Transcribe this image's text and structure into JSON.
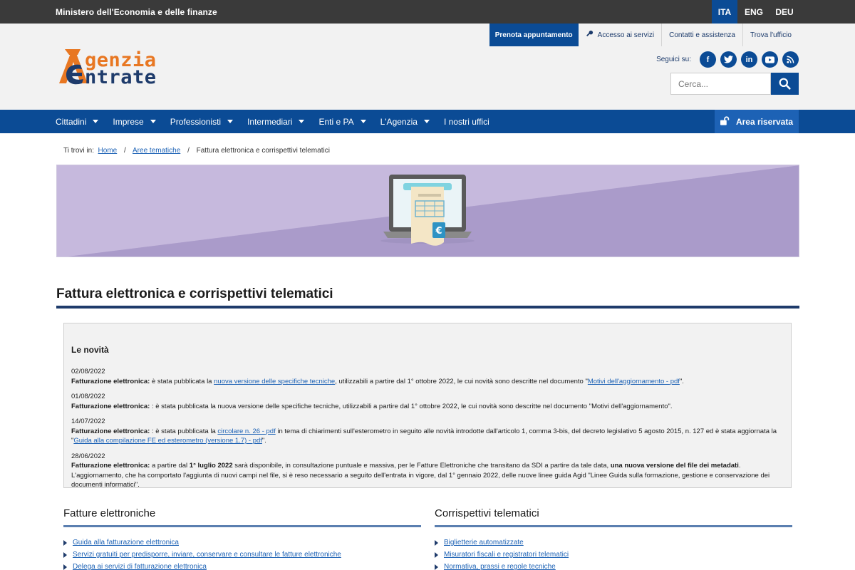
{
  "topbar": {
    "ministry": "Ministero dell'Economia e delle finanze",
    "languages": [
      {
        "label": "ITA",
        "active": true
      },
      {
        "label": "ENG",
        "active": false
      },
      {
        "label": "DEU",
        "active": false
      }
    ]
  },
  "logo": {
    "line1": "genzia",
    "line2": "ntrate"
  },
  "utility_nav": {
    "prenota": "Prenota appuntamento",
    "accesso": "Accesso ai servizi",
    "contatti": "Contatti e assistenza",
    "trova": "Trova l'ufficio"
  },
  "social": {
    "label": "Seguici su:",
    "icons": [
      "facebook-icon",
      "twitter-icon",
      "linkedin-icon",
      "youtube-icon",
      "rss-icon"
    ]
  },
  "search": {
    "placeholder": "Cerca..."
  },
  "main_nav": {
    "items": [
      "Cittadini",
      "Imprese",
      "Professionisti",
      "Intermediari",
      "Enti e PA",
      "L'Agenzia",
      "I nostri uffici"
    ],
    "area_riservata": "Area riservata"
  },
  "breadcrumb": {
    "prefix": "Ti trovi in:",
    "home": "Home",
    "aree": "Aree tematiche",
    "current": "Fattura elettronica e corrispettivi telematici"
  },
  "page": {
    "title": "Fattura elettronica e corrispettivi telematici"
  },
  "news": {
    "heading": "Le novità",
    "items": [
      {
        "date": "02/08/2022",
        "label": "Fatturazione elettronica:",
        "t1": " è stata pubblicata la ",
        "link1": "nuova versione delle specifiche tecniche",
        "t2": ", utilizzabili a partire dal 1° ottobre 2022, le cui novità sono descritte nel documento \"",
        "link2": "Motivi dell'aggiornamento - pdf",
        "t3": "\"."
      },
      {
        "date": "01/08/2022",
        "label": "Fatturazione elettronica:",
        "t1": " : è stata pubblicata la nuova versione delle specifiche tecniche, utilizzabili a partire dal 1° ottobre 2022, le cui novità sono descritte nel documento \"Motivi dell'aggiornamento\"."
      },
      {
        "date": "14/07/2022",
        "label": "Fatturazione elettronica:",
        "t1": " : è stata pubblicata la ",
        "link1": "circolare n. 26 - pdf",
        "t2": " in tema di chiarimenti sull'esterometro in seguito alle novità introdotte dall'articolo 1, comma 3-bis, del decreto legislativo 5 agosto 2015, n. 127 ed è stata aggiornata la \"",
        "link2": "Guida alla compilazione FE ed esterometro (versione 1.7) - pdf",
        "t3": "\"."
      },
      {
        "date": "28/06/2022",
        "label": "Fatturazione elettronica:",
        "t1": " a partire dal ",
        "b1": "1° luglio 2022",
        "t2": " sarà disponibile, in consultazione puntuale e massiva, per le Fatture Elettroniche che transitano da SDI a partire da tale data, ",
        "b2": "una nuova versione del file dei metadati",
        "t3": ". L'aggiornamento, che ha comportato l'aggiunta di nuovi campi nel file, si è reso necessario a seguito dell'entrata in vigore, dal 1° gennaio 2022, delle nuove linee guida Agid \"Linee Guida sulla formazione, gestione e conservazione dei documenti informatici\"."
      }
    ]
  },
  "fatture": {
    "title": "Fatture elettroniche",
    "links": [
      "Guida alla fatturazione elettronica",
      "Servizi gratuiti per predisporre, inviare, conservare e consultare le fatture elettroniche",
      "Delega ai servizi di fatturazione elettronica"
    ]
  },
  "corrispettivi": {
    "title": "Corrispettivi telematici",
    "links": [
      "Biglietterie automatizzate",
      "Misuratori fiscali e registratori telematici",
      "Normativa, prassi e regole tecniche"
    ]
  },
  "colors": {
    "primary": "#0b4b95",
    "dark_blue": "#1e3b6b",
    "orange": "#e87722",
    "hero_bg": "#b6a8cf"
  }
}
